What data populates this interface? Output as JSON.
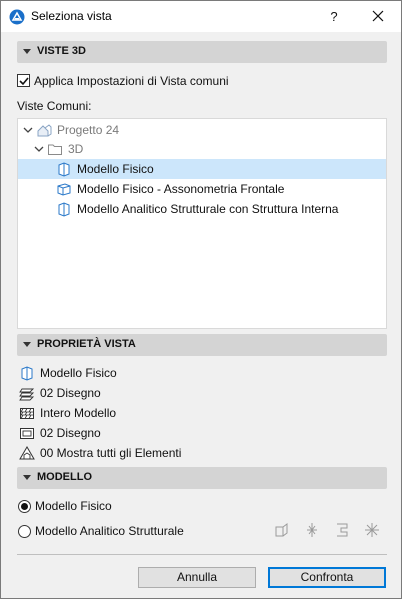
{
  "window": {
    "title": "Seleziona vista",
    "help_label": "?"
  },
  "viste3d": {
    "header": "VISTE 3D",
    "apply_common_label": "Applica Impostazioni di Vista comuni",
    "apply_common_checked": true,
    "common_views_label": "Viste Comuni:",
    "tree": [
      {
        "label": "Progetto 24",
        "level": 0,
        "expanded": true,
        "icon": "project-icon"
      },
      {
        "label": "3D",
        "level": 1,
        "expanded": true,
        "icon": "folder-icon"
      },
      {
        "label": "Modello Fisico",
        "level": 2,
        "selected": true,
        "icon": "view3d-icon"
      },
      {
        "label": "Modello Fisico - Assonometria Frontale",
        "level": 2,
        "icon": "axonometry-icon"
      },
      {
        "label": "Modello Analitico Strutturale con Struttura Interna",
        "level": 2,
        "icon": "view3d-icon"
      }
    ]
  },
  "proprieta": {
    "header": "PROPRIETÀ VISTA",
    "items": [
      {
        "label": "Modello Fisico",
        "icon": "model-view-icon"
      },
      {
        "label": "02 Disegno",
        "icon": "layers-icon"
      },
      {
        "label": "Intero Modello",
        "icon": "hatch-icon"
      },
      {
        "label": "02 Disegno",
        "icon": "pen-set-icon"
      },
      {
        "label": "00 Mostra tutti gli Elementi",
        "icon": "filter-icon"
      }
    ]
  },
  "modello": {
    "header": "MODELLO",
    "options": [
      {
        "label": "Modello Fisico",
        "selected": true
      },
      {
        "label": "Modello Analitico Strutturale",
        "selected": false
      }
    ]
  },
  "buttons": {
    "cancel": "Annulla",
    "confirm": "Confronta"
  },
  "colors": {
    "selection": "#cce6fb",
    "section_header": "#d4d4d4",
    "primary_border": "#0078d7"
  }
}
